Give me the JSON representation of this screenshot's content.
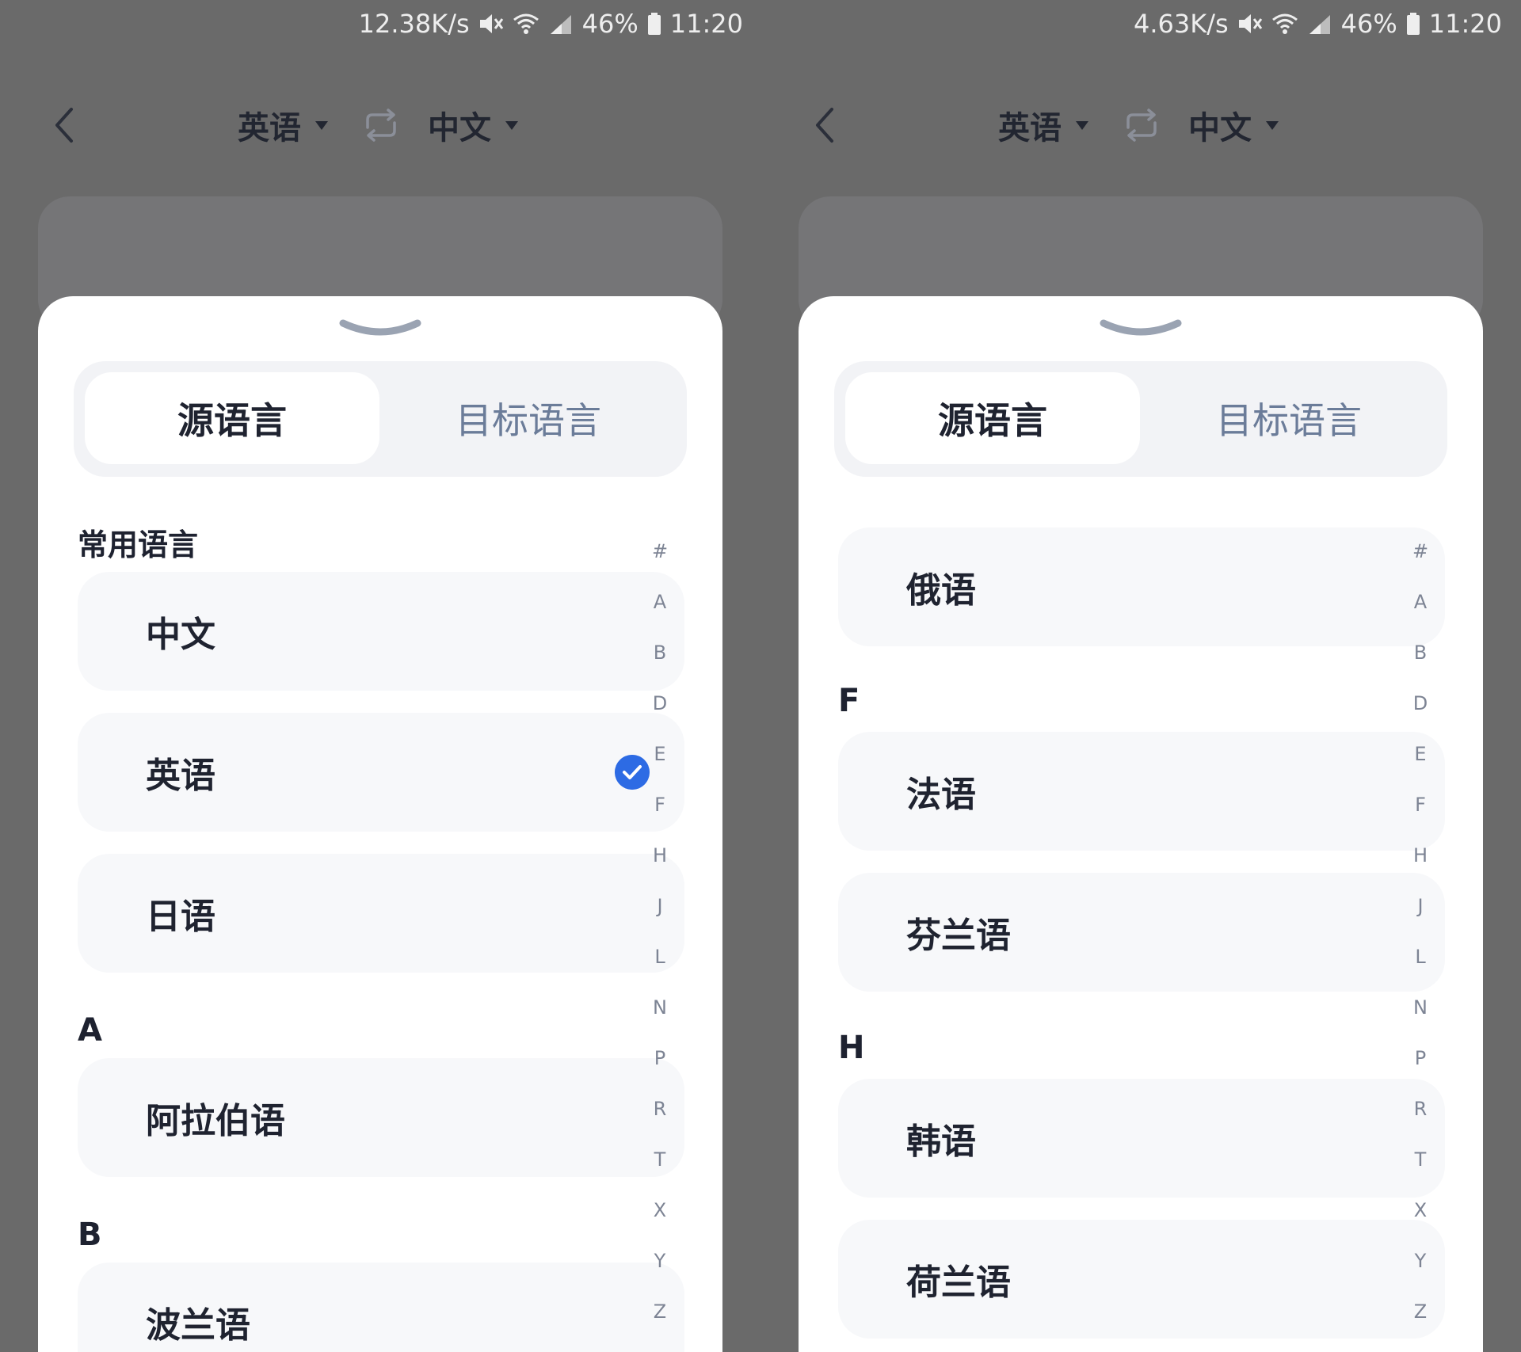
{
  "colors": {
    "backdrop": "#6a6a6a",
    "sheet": "#ffffff",
    "item_bg": "#f7f8fa",
    "tab_track": "#f2f3f6",
    "accent": "#2d6be4",
    "text_primary": "#1f2330",
    "text_muted": "#6b7c99"
  },
  "icons": {
    "back": "chevron-left-icon",
    "swap": "swap-icon",
    "caret": "caret-down-icon",
    "mute": "mute-icon",
    "wifi": "wifi-icon",
    "signal": "signal-icon",
    "battery": "battery-icon",
    "handle": "sheet-handle-icon",
    "check": "check-circle-icon"
  },
  "left": {
    "status": {
      "speed": "12.38K/s",
      "battery": "46%",
      "time": "11:20"
    },
    "header": {
      "source_lang": "英语",
      "target_lang": "中文"
    },
    "tabs": {
      "source": "源语言",
      "target": "目标语言"
    },
    "common_title": "常用语言",
    "common_items": [
      {
        "label": "中文",
        "selected": false
      },
      {
        "label": "英语",
        "selected": true
      },
      {
        "label": "日语",
        "selected": false
      }
    ],
    "section_a": "A",
    "a_items": [
      {
        "label": "阿拉伯语"
      }
    ],
    "section_b": "B",
    "b_items": [
      {
        "label": "波兰语"
      }
    ]
  },
  "right": {
    "status": {
      "speed": "4.63K/s",
      "battery": "46%",
      "time": "11:20"
    },
    "header": {
      "source_lang": "英语",
      "target_lang": "中文"
    },
    "tabs": {
      "source": "源语言",
      "target": "目标语言"
    },
    "top_items": [
      {
        "label": "俄语"
      }
    ],
    "section_f": "F",
    "f_items": [
      {
        "label": "法语"
      },
      {
        "label": "芬兰语"
      }
    ],
    "section_h": "H",
    "h_items": [
      {
        "label": "韩语"
      },
      {
        "label": "荷兰语"
      }
    ]
  },
  "index_letters": [
    "#",
    "A",
    "B",
    "D",
    "E",
    "F",
    "H",
    "J",
    "L",
    "N",
    "P",
    "R",
    "T",
    "X",
    "Y",
    "Z"
  ]
}
